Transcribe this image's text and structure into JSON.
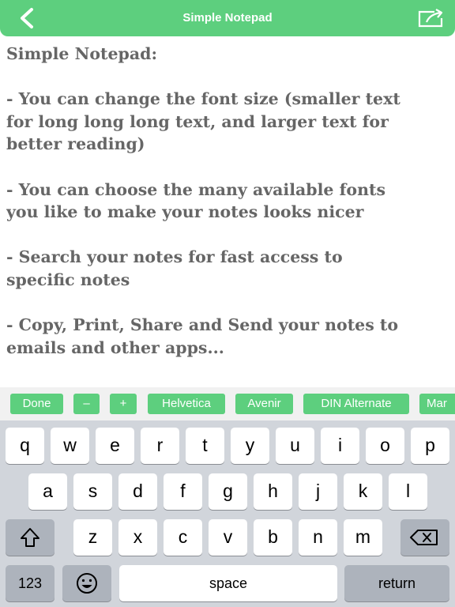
{
  "header": {
    "title": "Simple Notepad",
    "back_icon": "chevron-left-icon",
    "share_icon": "share-icon"
  },
  "note": {
    "lines": [
      "Simple Notepad:",
      "- You can change the font size (smaller text",
      "for long long long text, and larger text for",
      "better reading)",
      "- You can choose the many available fonts",
      "you like to make your notes looks nicer",
      "- Search your notes for fast access to",
      "specific notes",
      "- Copy, Print, Share and Send your notes to",
      "emails and other apps..."
    ]
  },
  "toolbar": {
    "done": "Done",
    "minus": "–",
    "plus": "+",
    "fonts": [
      "Helvetica",
      "Avenir",
      "DIN Alternate",
      "Mar"
    ]
  },
  "keyboard": {
    "row1": [
      "q",
      "w",
      "e",
      "r",
      "t",
      "y",
      "u",
      "i",
      "o",
      "p"
    ],
    "row2": [
      "a",
      "s",
      "d",
      "f",
      "g",
      "h",
      "j",
      "k",
      "l"
    ],
    "row3": [
      "z",
      "x",
      "c",
      "v",
      "b",
      "n",
      "m"
    ],
    "numbers": "123",
    "space": "space",
    "return": "return",
    "shift_icon": "shift-icon",
    "delete_icon": "backspace-icon",
    "emoji_icon": "emoji-icon"
  },
  "colors": {
    "accent": "#5dcf7e",
    "note_text": "#666666",
    "keyboard_bg": "#d1d5db"
  }
}
